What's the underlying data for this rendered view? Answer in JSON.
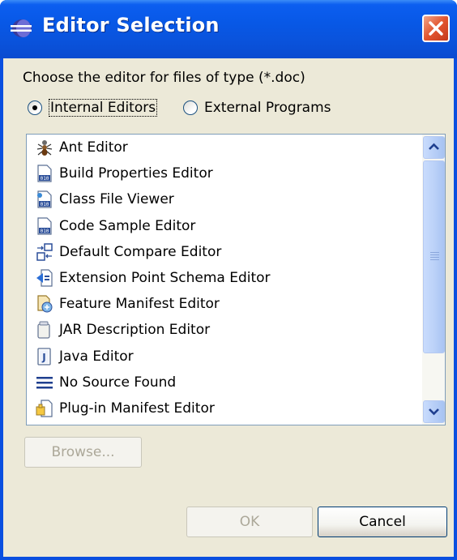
{
  "window": {
    "title": "Editor Selection",
    "colors": {
      "titlebar": "#0a53dc",
      "close": "#e2552f",
      "face": "#ece9d8",
      "selected_radio": "#000000"
    }
  },
  "prompt": "Choose the editor for files of type (*.doc)",
  "editor_source": {
    "options": [
      {
        "label": "Internal Editors",
        "checked": true
      },
      {
        "label": "External Programs",
        "checked": false
      }
    ]
  },
  "editors": [
    {
      "label": "Ant Editor",
      "icon": "ant-icon"
    },
    {
      "label": "Build Properties Editor",
      "icon": "binary-file-icon"
    },
    {
      "label": "Class File Viewer",
      "icon": "class-file-icon"
    },
    {
      "label": "Code Sample Editor",
      "icon": "binary-file-icon"
    },
    {
      "label": "Default Compare Editor",
      "icon": "compare-icon"
    },
    {
      "label": "Extension Point Schema Editor",
      "icon": "schema-icon"
    },
    {
      "label": "Feature Manifest Editor",
      "icon": "feature-icon"
    },
    {
      "label": "JAR Description Editor",
      "icon": "jar-icon"
    },
    {
      "label": "Java Editor",
      "icon": "java-file-icon"
    },
    {
      "label": "No Source Found",
      "icon": "lines-icon"
    },
    {
      "label": "Plug-in Manifest Editor",
      "icon": "plugin-icon"
    }
  ],
  "buttons": {
    "browse": "Browse...",
    "ok": "OK",
    "cancel": "Cancel"
  }
}
